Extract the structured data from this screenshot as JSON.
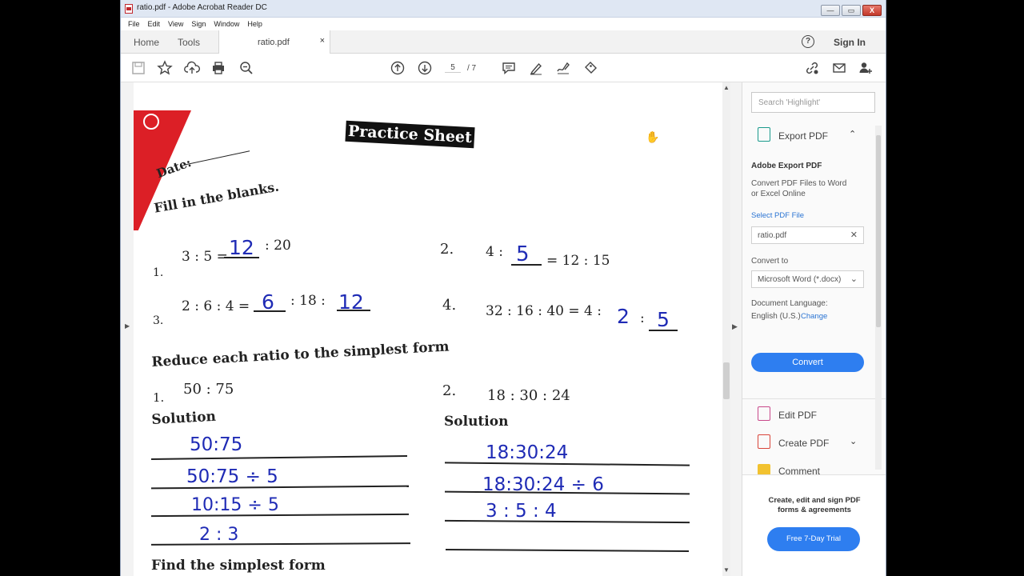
{
  "window": {
    "title": "ratio.pdf - Adobe Acrobat Reader DC",
    "minimize": "—",
    "maximize": "▭",
    "close": "X"
  },
  "menu": [
    "File",
    "Edit",
    "View",
    "Sign",
    "Window",
    "Help"
  ],
  "tabs": {
    "home": "Home",
    "tools": "Tools",
    "doc": "ratio.pdf",
    "doc_close": "×"
  },
  "header": {
    "help": "?",
    "sign_in": "Sign In"
  },
  "toolbar": {
    "page_current": "5",
    "page_total": "/ 7"
  },
  "document": {
    "title": "Practice Sheet",
    "date_label": "Date:",
    "section1": "Fill in the blanks.",
    "q1_num": "1.",
    "q1_text": "3 : 5 =",
    "q1_answer": "12",
    "q1_end": ": 20",
    "q2_num": "2.",
    "q2_text": "4 :",
    "q2_answer": "5",
    "q2_end": "= 12 : 15",
    "q3_num": "3.",
    "q3_text": "2 : 6 : 4 =",
    "q3_answer1": "6",
    "q3_mid": ": 18 :",
    "q3_answer2": "12",
    "q4_num": "4.",
    "q4_text": "32 : 16 : 40 = 4 :",
    "q4_answer1": "2",
    "q4_colon": ":",
    "q4_answer2": "5",
    "section2": "Reduce each ratio to the simplest form",
    "r1_num": "1.",
    "r1_text": "50 : 75",
    "r2_num": "2.",
    "r2_text": "18 : 30 : 24",
    "solution_label": "Solution",
    "sol1_lines": [
      "50:75",
      "50:75  ÷ 5",
      "10:15  ÷ 5",
      "2 : 3"
    ],
    "sol2_lines": [
      "18:30:24",
      "18:30:24 ÷ 6",
      "3 : 5 : 4"
    ],
    "section3": "Find the simplest form"
  },
  "panel": {
    "search_placeholder": "Search 'Highlight'",
    "export_label": "Export PDF",
    "export_chev": "⌃",
    "adobe_export_title": "Adobe Export PDF",
    "convert_desc_1": "Convert PDF Files to Word",
    "convert_desc_2": "or Excel Online",
    "select_file": "Select PDF File",
    "file_name": "ratio.pdf",
    "file_clear": "✕",
    "convert_to": "Convert to",
    "format": "Microsoft Word (*.docx)",
    "format_chev": "⌄",
    "doc_language": "Document Language:",
    "language": "English (U.S.)",
    "change": "Change",
    "convert_button": "Convert",
    "edit_pdf": "Edit PDF",
    "create_pdf": "Create PDF",
    "create_chev": "⌄",
    "comment": "Comment",
    "promo_text": "Create, edit and sign PDF forms & agreements",
    "trial_button": "Free 7-Day Trial"
  },
  "colors": {
    "accent": "#2e7ef0",
    "ink": "#1f2bb5",
    "red": "#dc1f26"
  }
}
